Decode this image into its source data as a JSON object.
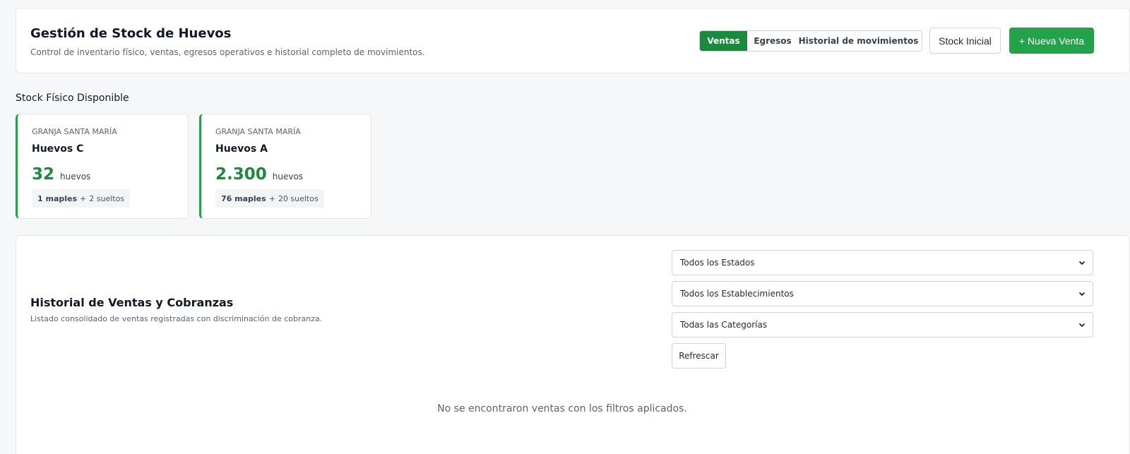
{
  "header": {
    "title": "Gestión de Stock de Huevos",
    "subtitle": "Control de inventario físico, ventas, egresos operativos e historial completo de movimientos.",
    "tabs": [
      {
        "label": "Ventas",
        "active": true
      },
      {
        "label": "Egresos",
        "active": false
      },
      {
        "label": "Historial de movimientos",
        "active": false
      }
    ],
    "stock_inicial_label": "Stock Inicial",
    "nueva_venta_label": "+ Nueva Venta"
  },
  "stock": {
    "section_title": "Stock Físico Disponible",
    "cards": [
      {
        "farm": "GRANJA SANTA MARÍA",
        "product": "Huevos C",
        "quantity": "32",
        "unit": "huevos",
        "maples": "1 maples",
        "plus": "+",
        "sueltos": "2 sueltos"
      },
      {
        "farm": "GRANJA SANTA MARÍA",
        "product": "Huevos A",
        "quantity": "2.300",
        "unit": "huevos",
        "maples": "76 maples",
        "plus": "+",
        "sueltos": "20 sueltos"
      }
    ]
  },
  "sales": {
    "title": "Historial de Ventas y Cobranzas",
    "subtitle": "Listado consolidado de ventas registradas con discriminación de cobranza.",
    "filters": {
      "estado": "Todos los Estados",
      "establecimiento": "Todos los Establecimientos",
      "categoria": "Todas las Categorías"
    },
    "refresh_label": "Refrescar",
    "empty_message": "No se encontraron ventas con los filtros aplicados."
  },
  "colors": {
    "accent": "#1a8a3c",
    "primary_button": "#22a34a",
    "card_border_accent": "#22a34a"
  }
}
